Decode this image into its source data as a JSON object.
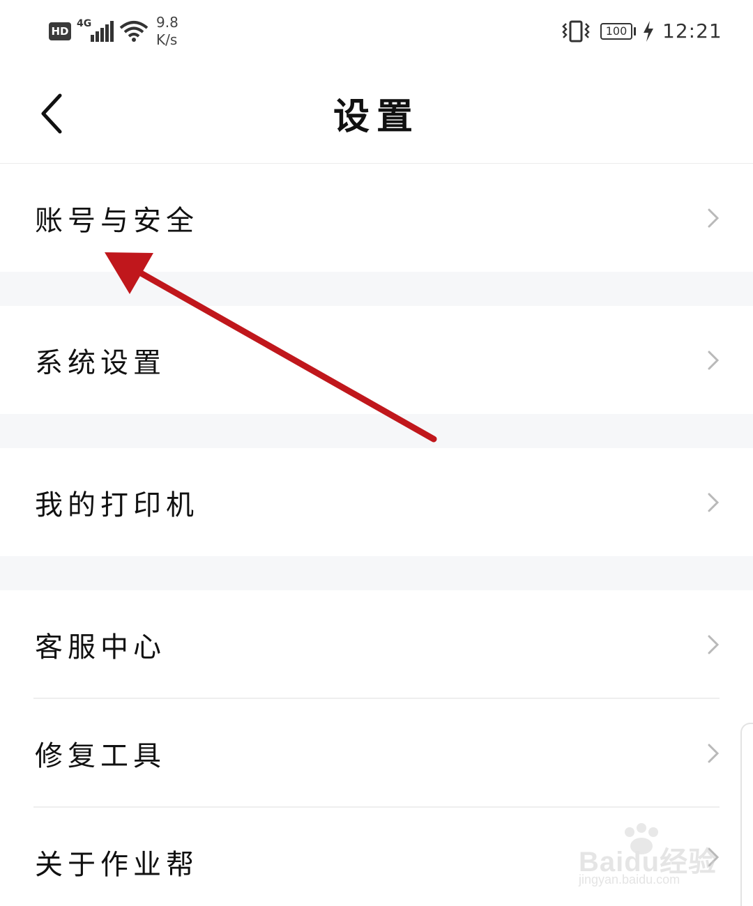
{
  "status_bar": {
    "hd_badge": "HD",
    "network_type": "4G",
    "speed_value": "9.8",
    "speed_unit": "K/s",
    "battery_level": "100",
    "time": "12:21"
  },
  "header": {
    "title": "设置",
    "back_icon": "chevron-left-icon"
  },
  "menu": {
    "items": [
      {
        "label": "账号与安全"
      },
      {
        "label": "系统设置"
      },
      {
        "label": "我的打印机"
      },
      {
        "label": "客服中心"
      },
      {
        "label": "修复工具"
      },
      {
        "label": "关于作业帮"
      }
    ],
    "chevron_icon": "chevron-right-icon"
  },
  "annotation": {
    "arrow_color": "#c0171c"
  },
  "watermark": {
    "logo": "Baidu经验",
    "url": "jingyan.baidu.com"
  },
  "colors": {
    "section_gap": "#f6f7f9",
    "chevron": "#b9b9b9",
    "text": "#111111"
  }
}
